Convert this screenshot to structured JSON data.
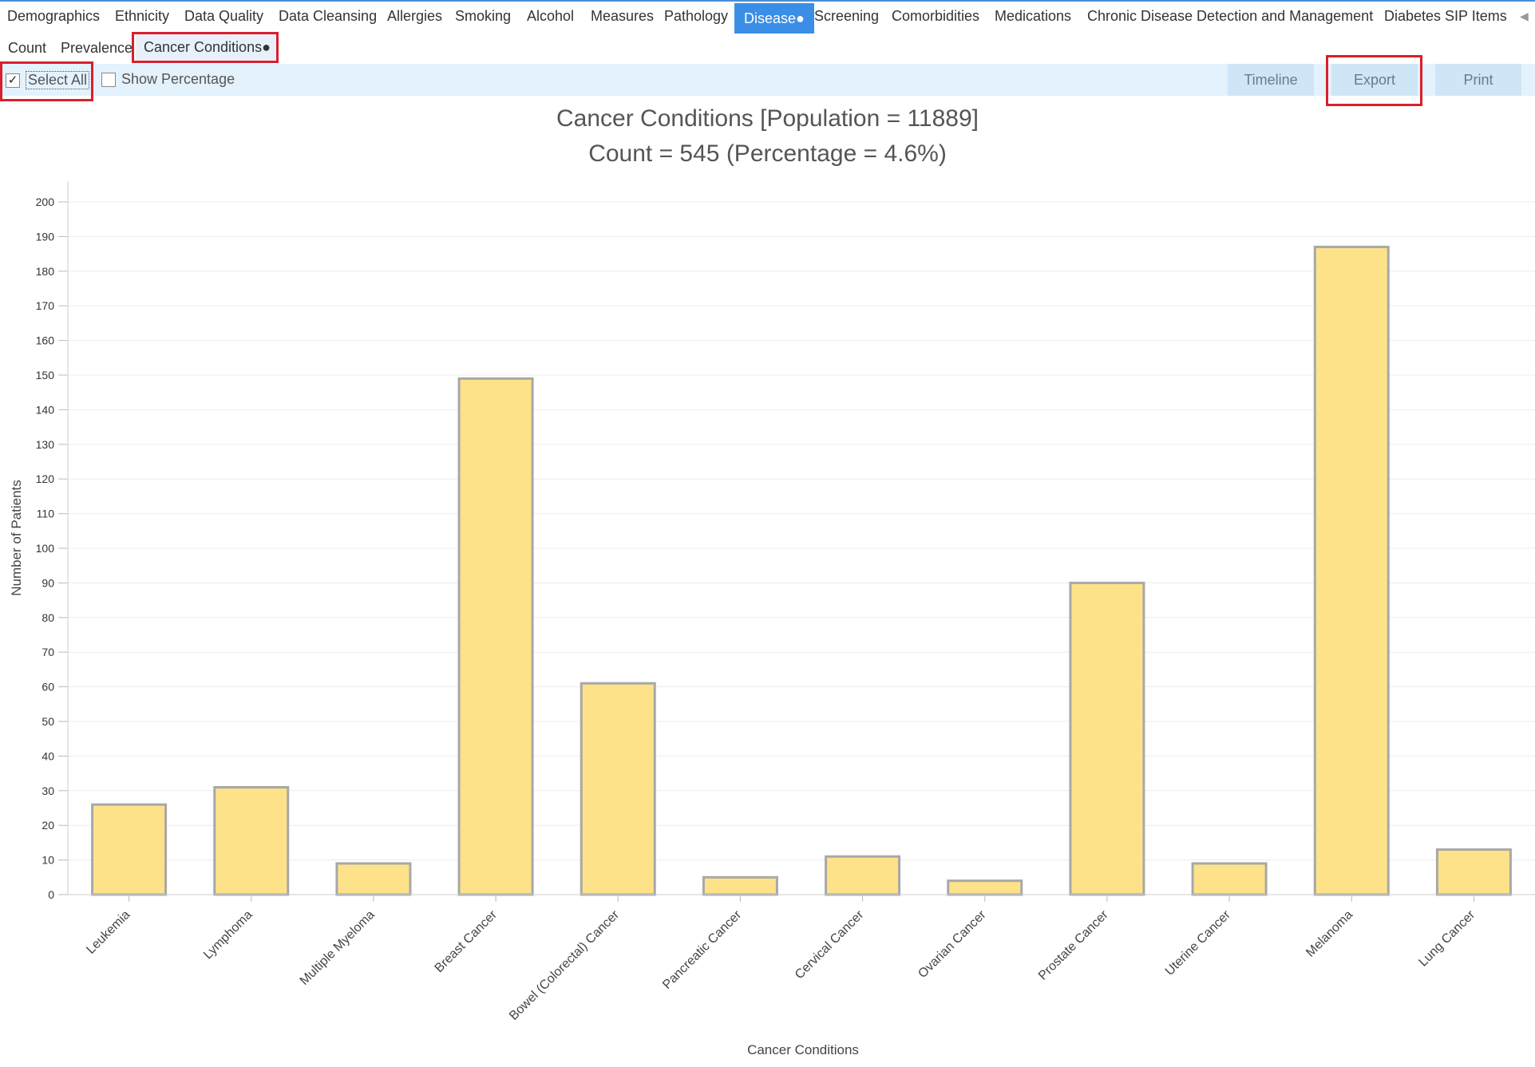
{
  "tabs": [
    {
      "label": "Demographics"
    },
    {
      "label": "Ethnicity"
    },
    {
      "label": "Data Quality"
    },
    {
      "label": "Data Cleansing"
    },
    {
      "label": "Allergies"
    },
    {
      "label": "Smoking"
    },
    {
      "label": "Alcohol"
    },
    {
      "label": "Measures"
    },
    {
      "label": "Pathology"
    },
    {
      "label": "Disease●",
      "active": true
    },
    {
      "label": "Screening"
    },
    {
      "label": "Comorbidities"
    },
    {
      "label": "Medications"
    },
    {
      "label": "Chronic Disease Detection and Management"
    },
    {
      "label": "Diabetes SIP Items"
    }
  ],
  "subtabs": [
    {
      "label": "Count"
    },
    {
      "label": "Prevalence"
    },
    {
      "label": "Cancer Conditions●",
      "active": true
    }
  ],
  "toolbar": {
    "select_all": {
      "label": "Select All",
      "checked": true
    },
    "show_percentage": {
      "label": "Show Percentage",
      "checked": false
    },
    "timeline_label": "Timeline",
    "export_label": "Export",
    "print_label": "Print"
  },
  "colors": {
    "accent": "#3a8ee6",
    "toolbar_bg": "#e3f2fc",
    "highlight": "#d9202a",
    "bar_fill": "#fde28a",
    "bar_stroke": "#a8a8a8"
  },
  "chart_data": {
    "type": "bar",
    "title_line1": "Cancer Conditions [Population = 11889]",
    "title_line2": "Count = 545 (Percentage = 4.6%)",
    "xlabel": "Cancer Conditions",
    "ylabel": "Number of Patients",
    "ylim": [
      0,
      200
    ],
    "ytick_step": 10,
    "grid": true,
    "categories": [
      "Leukemia",
      "Lymphoma",
      "Multiple Myeloma",
      "Breast Cancer",
      "Bowel (Colorectal) Cancer",
      "Pancreatic Cancer",
      "Cervical Cancer",
      "Ovarian Cancer",
      "Prostate Cancer",
      "Uterine Cancer",
      "Melanoma",
      "Lung Cancer"
    ],
    "values": [
      26,
      31,
      9,
      149,
      61,
      5,
      11,
      4,
      90,
      9,
      187,
      13
    ]
  }
}
